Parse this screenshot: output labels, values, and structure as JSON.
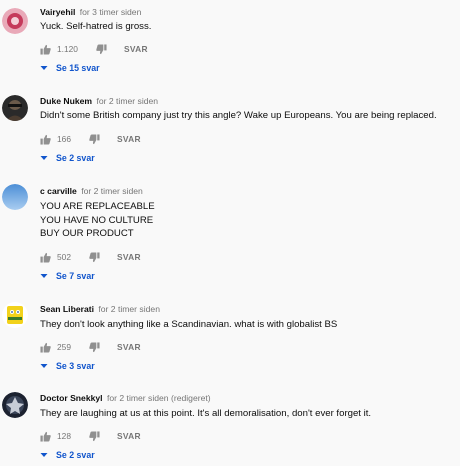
{
  "comments": [
    {
      "author": "Vairyehil",
      "time": "for 3 timer siden",
      "lines": [
        "Yuck. Self-hatred is gross."
      ],
      "likes": "1.120",
      "reply_label": "SVAR",
      "replies_label": "Se 15 svar"
    },
    {
      "author": "Duke Nukem",
      "time": "for 2 timer siden",
      "lines": [
        "Didn't some British company just try this angle? Wake up Europeans. You are being replaced."
      ],
      "likes": "166",
      "reply_label": "SVAR",
      "replies_label": "Se 2 svar"
    },
    {
      "author": "c carville",
      "time": "for 2 timer siden",
      "lines": [
        "YOU ARE REPLACEABLE",
        "YOU HAVE NO CULTURE",
        "BUY OUR PRODUCT"
      ],
      "likes": "502",
      "reply_label": "SVAR",
      "replies_label": "Se 7 svar"
    },
    {
      "author": "Sean Liberati",
      "time": "for 2 timer siden",
      "lines": [
        "They don't look anything like a Scandinavian. what is with globalist BS"
      ],
      "likes": "259",
      "reply_label": "SVAR",
      "replies_label": "Se 3 svar"
    },
    {
      "author": "Doctor Snekkyl",
      "time": "for 2 timer siden (redigeret)",
      "lines": [
        "They are laughing at us at this point. It's all demoralisation, don't ever forget it."
      ],
      "likes": "128",
      "reply_label": "SVAR",
      "replies_label": "Se 2 svar"
    }
  ],
  "colors": {
    "link": "#1155cc",
    "meta": "#767676",
    "text": "#0d0d0d",
    "background": "#f9f9f9"
  },
  "icons": [
    "thumbs-up-icon",
    "thumbs-down-icon",
    "chevron-down-icon"
  ]
}
